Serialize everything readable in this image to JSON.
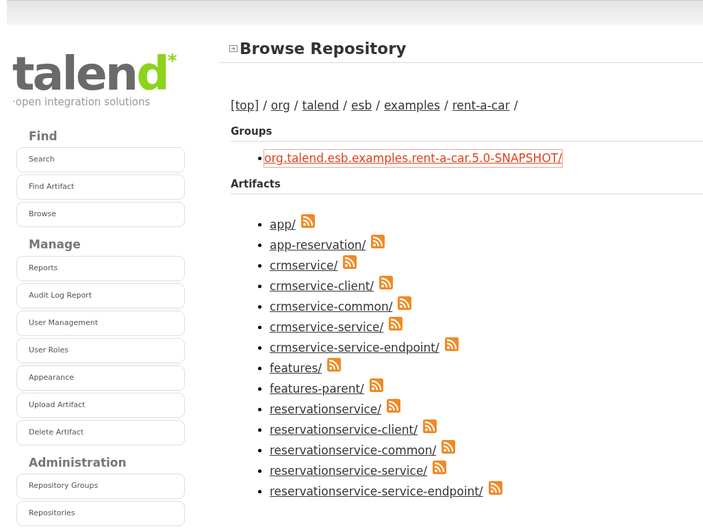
{
  "logo": {
    "main": "talen",
    "accent": "d",
    "mark": "*",
    "tagline": "·open integration solutions"
  },
  "sidebar": {
    "sections": [
      {
        "title": "Find",
        "items": [
          "Search",
          "Find Artifact",
          "Browse"
        ]
      },
      {
        "title": "Manage",
        "items": [
          "Reports",
          "Audit Log Report",
          "User Management",
          "User Roles",
          "Appearance",
          "Upload Artifact",
          "Delete Artifact"
        ]
      },
      {
        "title": "Administration",
        "items": [
          "Repository Groups",
          "Repositories"
        ]
      }
    ]
  },
  "page": {
    "title": "Browse Repository",
    "breadcrumb": [
      "[top]",
      "org",
      "talend",
      "esb",
      "examples",
      "rent-a-car"
    ],
    "separator": "/",
    "groups_heading": "Groups",
    "groups": [
      {
        "label": "org.talend.esb.examples.rent-a-car.5.0-SNAPSHOT/",
        "focused": true
      }
    ],
    "artifacts_heading": "Artifacts",
    "artifacts": [
      "app/",
      "app-reservation/",
      "crmservice/",
      "crmservice-client/",
      "crmservice-common/",
      "crmservice-service/",
      "crmservice-service-endpoint/",
      "features/",
      "features-parent/",
      "reservationservice/",
      "reservationservice-client/",
      "reservationservice-common/",
      "reservationservice-service/",
      "reservationservice-service-endpoint/"
    ]
  }
}
